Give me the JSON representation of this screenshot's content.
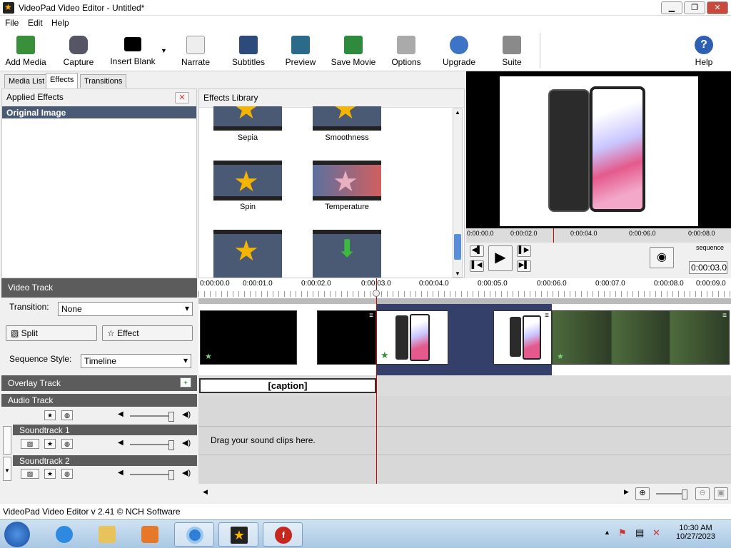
{
  "window": {
    "title": "VideoPad Video Editor - Untitled*",
    "minimize": "▁",
    "maximize": "❐",
    "close": "✕"
  },
  "menu": [
    "File",
    "Edit",
    "Help"
  ],
  "toolbar": {
    "add_media": "Add Media",
    "capture": "Capture",
    "insert_blank": "Insert Blank",
    "narrate": "Narrate",
    "subtitles": "Subtitles",
    "preview": "Preview",
    "save_movie": "Save Movie",
    "options": "Options",
    "upgrade": "Upgrade",
    "suite": "Suite",
    "help": "Help"
  },
  "tabs": {
    "media_list": "Media List",
    "effects": "Effects",
    "transitions": "Transitions"
  },
  "applied_effects": {
    "title": "Applied Effects",
    "original_image": "Original Image",
    "remove": "✕"
  },
  "effects_library": {
    "title": "Effects Library",
    "items": [
      "Sepia",
      "Smoothness",
      "Spin",
      "Temperature"
    ]
  },
  "preview": {
    "ruler": [
      "0:00:00.0",
      "0:00:02.0",
      "0:00:04.0",
      "0:00:06.0",
      "0:00:08.0"
    ],
    "mode": "sequence",
    "time": "0:00:03.0"
  },
  "video_track": {
    "title": "Video Track",
    "transition_label": "Transition:",
    "transition_value": "None",
    "split": "Split",
    "effect": "Effect",
    "sequence_style_label": "Sequence Style:",
    "sequence_style_value": "Timeline"
  },
  "overlay_track": {
    "title": "Overlay Track",
    "clip_text": "[caption]"
  },
  "audio_track": {
    "title": "Audio Track",
    "soundtrack1": "Soundtrack 1",
    "soundtrack2": "Soundtrack 2",
    "drop_hint": "Drag your sound clips here."
  },
  "timeline_ruler": [
    "0:00:00.0",
    "0:00:01.0",
    "0:00:02.0",
    "0:00:03.0",
    "0:00:04.0",
    "0:00:05.0",
    "0:00:06.0",
    "0:00:07.0",
    "0:00:08.0",
    "0:00:09.0"
  ],
  "statusbar": "VideoPad Video Editor v 2.41 © NCH Software",
  "clock": {
    "time": "10:30 AM",
    "date": "10/27/2023"
  }
}
